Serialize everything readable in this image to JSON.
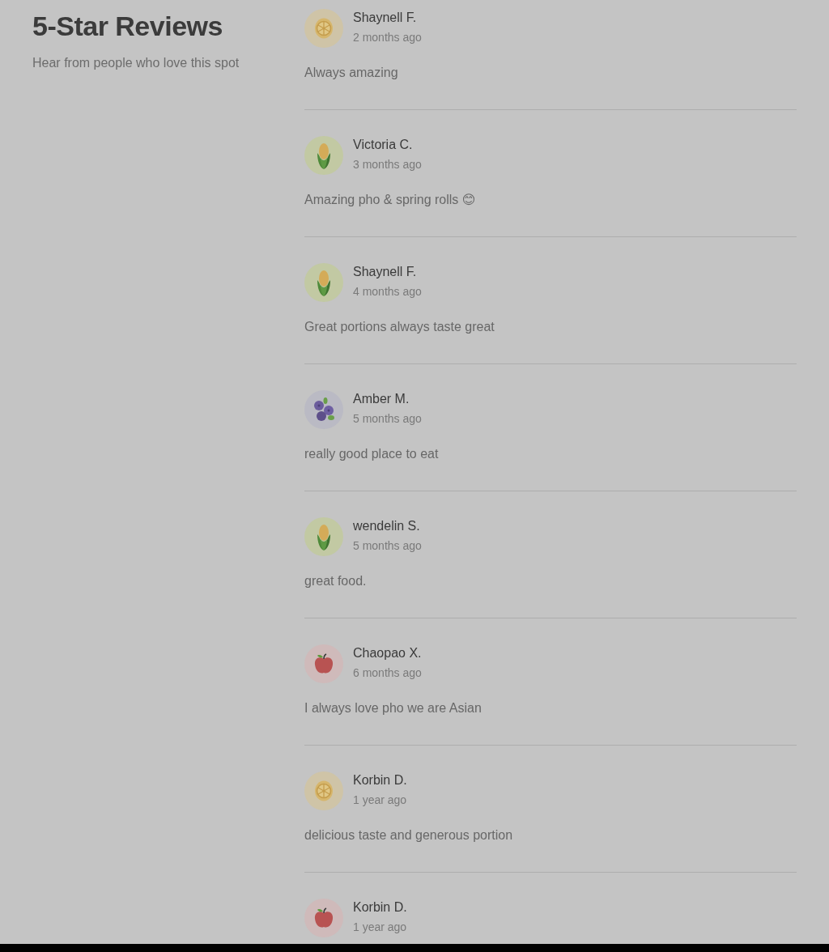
{
  "header": {
    "title": "5-Star Reviews",
    "subtitle": "Hear from people who love this spot"
  },
  "reviews": [
    {
      "kind": "citrus",
      "name": "Shaynell F.",
      "time": "2 months ago",
      "text": "Always amazing"
    },
    {
      "kind": "corn",
      "name": "Victoria C.",
      "time": "3 months ago",
      "text": "Amazing pho & spring rolls 😊"
    },
    {
      "kind": "corn",
      "name": "Shaynell F.",
      "time": "4 months ago",
      "text": "Great portions always taste great"
    },
    {
      "kind": "berries",
      "name": "Amber M.",
      "time": "5 months ago",
      "text": "really good place to eat"
    },
    {
      "kind": "corn",
      "name": "wendelin S.",
      "time": "5 months ago",
      "text": "great food."
    },
    {
      "kind": "apple",
      "name": "Chaopao X.",
      "time": "6 months ago",
      "text": "I always love pho we are Asian"
    },
    {
      "kind": "citrus",
      "name": "Korbin D.",
      "time": "1 year ago",
      "text": "delicious taste and generous portion"
    },
    {
      "kind": "apple",
      "name": "Korbin D.",
      "time": "1 year ago"
    }
  ]
}
